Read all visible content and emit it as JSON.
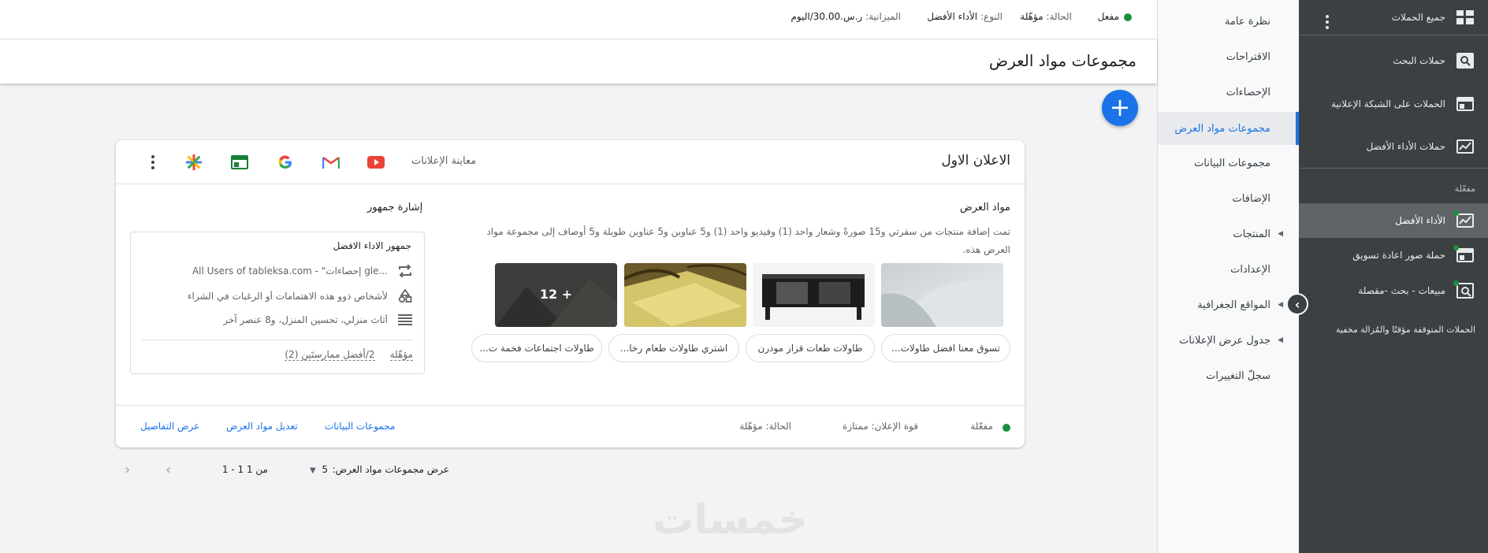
{
  "dark_sidebar": {
    "items": [
      {
        "label": "جميع الحملات",
        "icon": "grid-icon"
      },
      {
        "label": "حملات البحث",
        "icon": "search-campaign-icon"
      },
      {
        "label": "الحملات على الشبكة الإعلانية",
        "icon": "display-icon"
      },
      {
        "label": "حملات الأداء الأفضل",
        "icon": "performance-icon"
      }
    ],
    "section_label": "مفعّلة",
    "enabled_items": [
      {
        "label": "الأداء الأفضل",
        "icon": "performance-icon",
        "active": true
      },
      {
        "label": "حملة صور اعادة تسويق",
        "icon": "display-icon"
      },
      {
        "label": "مبيعات - بحث -مفصلة",
        "icon": "search-campaign-icon"
      }
    ],
    "paused_label": "الحملات المتوقفة مؤقتًا والمُزالة مخفية"
  },
  "nav": {
    "items": [
      {
        "label": "نظرة عامة"
      },
      {
        "label": "الاقتراحات"
      },
      {
        "label": "الإحصاءات"
      },
      {
        "label": "مجموعات مواد العرض",
        "active": true
      },
      {
        "label": "مجموعات البيانات"
      },
      {
        "label": "الإضافات"
      },
      {
        "label": "المنتجات",
        "caret": true
      },
      {
        "label": "الإعدادات"
      },
      {
        "label": "المواقع الجغرافية",
        "caret": true
      },
      {
        "label": "جدول عرض الإعلانات",
        "caret": true
      },
      {
        "label": "سجلّ التغييرات"
      }
    ]
  },
  "status_bar": {
    "status_value": "مفعل",
    "state_label": "الحالة:",
    "state_value": "مؤهّلة",
    "type_label": "النوع:",
    "type_value": "الأداء الأفضل",
    "budget_label": "الميزانية:",
    "budget_value": "ر.س.30.00/اليوم"
  },
  "page": {
    "title": "مجموعات مواد العرض"
  },
  "card": {
    "ad_name": "الاعلان الاول",
    "preview_label": "معاينة الإعلانات",
    "assets_title": "مواد العرض",
    "assets_desc": "تمت إضافة منتجات من سفرتي و15 صورةً وشعار واحد (1) وفيديو واحد (1) و5 عناوين و5 عناوين طويلة و5 أوصاف إلى مجموعة مواد العرض هذه.",
    "more_images": "12 +",
    "chips": [
      "تسوق معنا افضل طاولات...",
      "طاولات طعات قزاز مودرن",
      "اشتري طاولات طعام رخا...",
      "طاولات اجتماعات فخمة ت..."
    ],
    "signal_title": "إشارة جمهور",
    "audience_name": "جمهور الاداء الافضل",
    "signals": [
      {
        "icon": "remarketing-icon",
        "text": "All Users of tableksa.com - \"إحصاءات gle..."
      },
      {
        "icon": "interests-icon",
        "text": "لأشخاص ذوو هذه الاهتمامات أو الرغبات في الشراء"
      },
      {
        "icon": "list-icon",
        "text": "أثاث منزلي، تحسين المنزل، و8 عنصر آخر"
      }
    ],
    "signal_status": "مؤهّلة",
    "signal_best": "2/أفضل ممارستَين (2)",
    "footer": {
      "status": "مفعّلة",
      "strength_label": "قوة الإعلان:",
      "strength_value": "ممتازة",
      "state_label": "الحالة:",
      "state_value": "مؤهّلة",
      "link_details": "عرض التفاصيل",
      "link_edit": "تعديل مواد العرض",
      "link_datasets": "مجموعات البيانات"
    }
  },
  "pager": {
    "rows_label": "عرض مجموعات مواد العرض:",
    "rows_value": "5",
    "range": "1 - 1 من 1"
  },
  "watermark": "خمسات",
  "colors": {
    "accent": "#1a73e8",
    "enabled_green": "#1e8e3e",
    "sidebar_dark": "#3c4043"
  }
}
